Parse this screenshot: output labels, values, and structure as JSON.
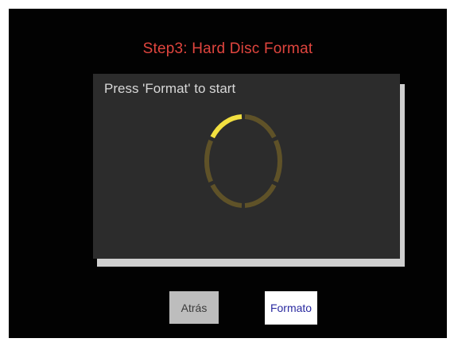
{
  "title": "Step3: Hard Disc Format",
  "panel": {
    "instruction": "Press 'Format' to start",
    "progress_icon": "loading-ring-icon",
    "progress_segments_active": 1,
    "progress_segments_total": 6
  },
  "buttons": {
    "back_label": "Atrás",
    "format_label": "Formato"
  },
  "colors": {
    "title": "#e0453e",
    "active_segment": "#f2e040",
    "inactive_segment": "#5f5228",
    "panel_bg": "#2c2c2c",
    "screen_bg": "#020202"
  }
}
